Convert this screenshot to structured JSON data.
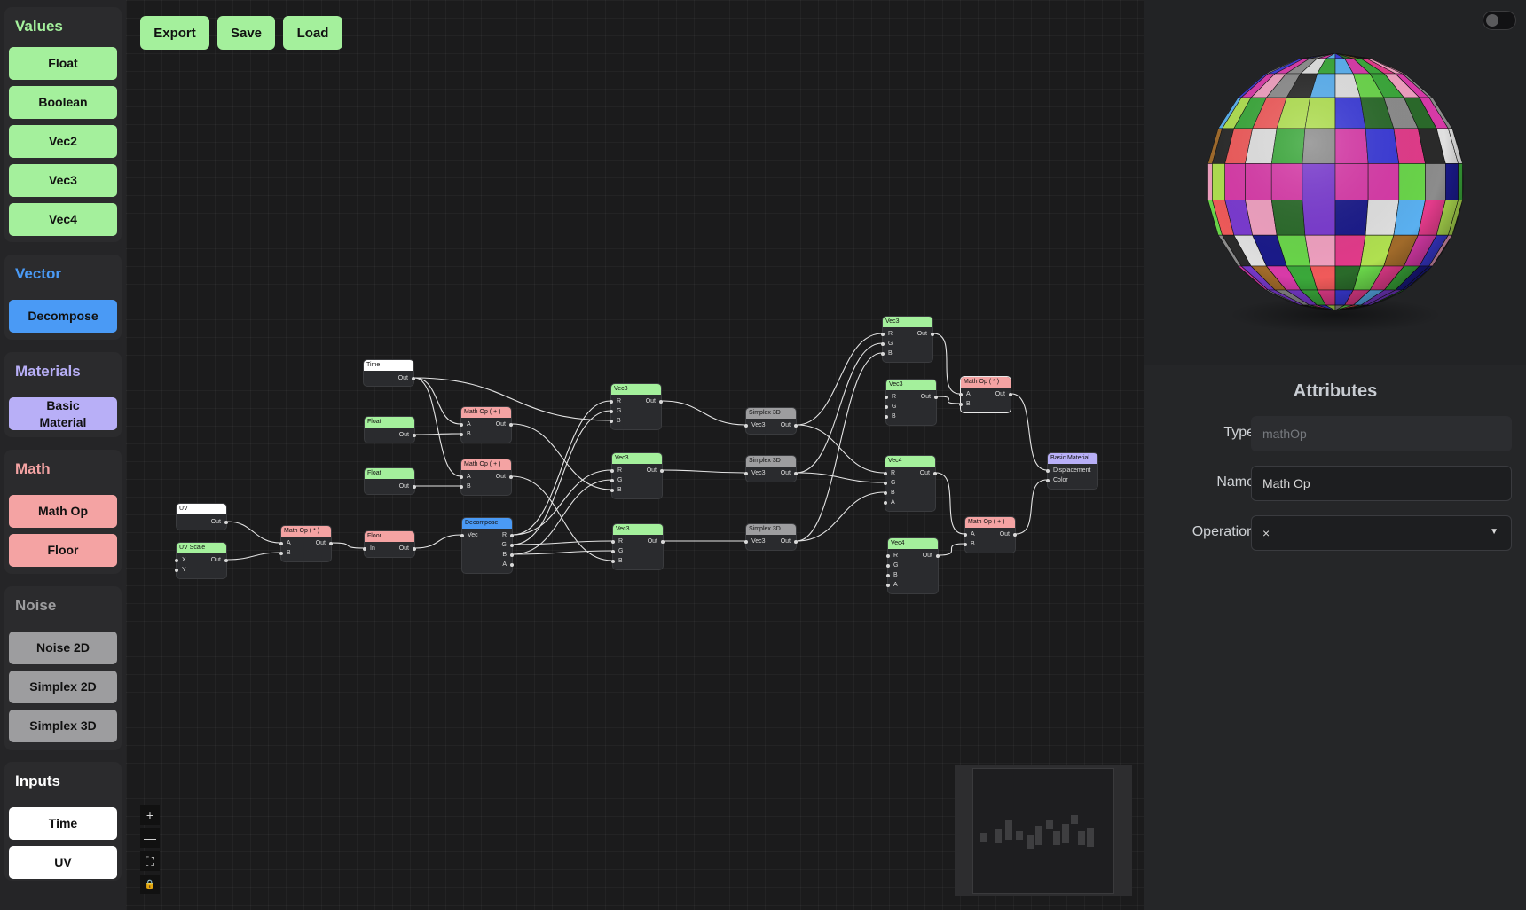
{
  "sidebar": {
    "categories": [
      {
        "title": "Values",
        "color": "#a4f09c",
        "items": [
          "Float",
          "Boolean",
          "Vec2",
          "Vec3",
          "Vec4"
        ]
      },
      {
        "title": "Vector",
        "color": "#4a9af5",
        "items": [
          "Decompose"
        ]
      },
      {
        "title": "Materials",
        "color": "#b8aff7",
        "items": [
          "Basic\nMaterial"
        ]
      },
      {
        "title": "Math",
        "color": "#f4a3a3",
        "items": [
          "Math Op",
          "Floor"
        ]
      },
      {
        "title": "Noise",
        "color": "#9d9d9f",
        "items": [
          "Noise 2D",
          "Simplex 2D",
          "Simplex 3D"
        ]
      },
      {
        "title": "Inputs",
        "color": "#ffffff",
        "items": [
          "Time",
          "UV"
        ]
      }
    ]
  },
  "toolbar": {
    "export_label": "Export",
    "save_label": "Save",
    "load_label": "Load",
    "button_color": "#a4f09c"
  },
  "graph": {
    "nodes": [
      {
        "id": "uv",
        "title": "UV",
        "color": "#ffffff",
        "inputs": [],
        "outputs": [
          "Out"
        ]
      },
      {
        "id": "uvscale",
        "title": "UV Scale",
        "color": "#a4f09c",
        "inputs": [
          "X",
          "Y"
        ],
        "outputs": [
          "Out"
        ]
      },
      {
        "id": "mul1",
        "title": "Math Op ( * )",
        "color": "#f4a3a3",
        "inputs": [
          "A",
          "B"
        ],
        "outputs": [
          "Out"
        ]
      },
      {
        "id": "floor",
        "title": "Floor",
        "color": "#f4a3a3",
        "inputs": [
          "In"
        ],
        "outputs": [
          "Out"
        ]
      },
      {
        "id": "time",
        "title": "Time",
        "color": "#ffffff",
        "inputs": [],
        "outputs": [
          "Out"
        ]
      },
      {
        "id": "float1",
        "title": "Float",
        "color": "#a4f09c",
        "inputs": [],
        "outputs": [
          "Out"
        ]
      },
      {
        "id": "float2",
        "title": "Float",
        "color": "#a4f09c",
        "inputs": [],
        "outputs": [
          "Out"
        ]
      },
      {
        "id": "add1",
        "title": "Math Op ( + )",
        "color": "#f4a3a3",
        "inputs": [
          "A",
          "B"
        ],
        "outputs": [
          "Out"
        ]
      },
      {
        "id": "add2",
        "title": "Math Op ( + )",
        "color": "#f4a3a3",
        "inputs": [
          "A",
          "B"
        ],
        "outputs": [
          "Out"
        ]
      },
      {
        "id": "decompose",
        "title": "Decompose",
        "color": "#4a9af5",
        "inputs": [
          "Vec"
        ],
        "outputs": [
          "R",
          "G",
          "B",
          "A"
        ]
      },
      {
        "id": "vec3a",
        "title": "Vec3",
        "color": "#a4f09c",
        "inputs": [
          "R",
          "G",
          "B"
        ],
        "outputs": [
          "Out"
        ]
      },
      {
        "id": "vec3b",
        "title": "Vec3",
        "color": "#a4f09c",
        "inputs": [
          "R",
          "G",
          "B"
        ],
        "outputs": [
          "Out"
        ]
      },
      {
        "id": "vec3c",
        "title": "Vec3",
        "color": "#a4f09c",
        "inputs": [
          "R",
          "G",
          "B"
        ],
        "outputs": [
          "Out"
        ]
      },
      {
        "id": "simp1",
        "title": "Simplex 3D",
        "color": "#9d9d9f",
        "inputs": [
          "Vec3"
        ],
        "outputs": [
          "Out"
        ]
      },
      {
        "id": "simp2",
        "title": "Simplex 3D",
        "color": "#9d9d9f",
        "inputs": [
          "Vec3"
        ],
        "outputs": [
          "Out"
        ]
      },
      {
        "id": "simp3",
        "title": "Simplex 3D",
        "color": "#9d9d9f",
        "inputs": [
          "Vec3"
        ],
        "outputs": [
          "Out"
        ]
      },
      {
        "id": "vec3d",
        "title": "Vec3",
        "color": "#a4f09c",
        "inputs": [
          "R",
          "G",
          "B"
        ],
        "outputs": [
          "Out"
        ]
      },
      {
        "id": "vec3e",
        "title": "Vec3",
        "color": "#a4f09c",
        "inputs": [
          "R",
          "G",
          "B"
        ],
        "outputs": [
          "Out"
        ]
      },
      {
        "id": "vec4a",
        "title": "Vec4",
        "color": "#a4f09c",
        "inputs": [
          "R",
          "G",
          "B",
          "A"
        ],
        "outputs": [
          "Out"
        ]
      },
      {
        "id": "vec4b",
        "title": "Vec4",
        "color": "#a4f09c",
        "inputs": [
          "R",
          "G",
          "B",
          "A"
        ],
        "outputs": [
          "Out"
        ]
      },
      {
        "id": "mul2",
        "title": "Math Op ( * )",
        "color": "#f4a3a3",
        "inputs": [
          "A",
          "B"
        ],
        "outputs": [
          "Out"
        ],
        "selected": true
      },
      {
        "id": "add3",
        "title": "Math Op ( + )",
        "color": "#f4a3a3",
        "inputs": [
          "A",
          "B"
        ],
        "outputs": [
          "Out"
        ]
      },
      {
        "id": "basicmat",
        "title": "Basic Material",
        "color": "#b8aff7",
        "inputs": [
          "Displacement",
          "Color"
        ],
        "outputs": []
      }
    ],
    "edges": [
      [
        "uv",
        "Out",
        "mul1",
        "A"
      ],
      [
        "uvscale",
        "Out",
        "mul1",
        "B"
      ],
      [
        "mul1",
        "Out",
        "floor",
        "In"
      ],
      [
        "floor",
        "Out",
        "decompose",
        "Vec"
      ],
      [
        "time",
        "Out",
        "add1",
        "A"
      ],
      [
        "time",
        "Out",
        "add2",
        "A"
      ],
      [
        "time",
        "Out",
        "vec3a",
        "B"
      ],
      [
        "float1",
        "Out",
        "add1",
        "B"
      ],
      [
        "float2",
        "Out",
        "add2",
        "B"
      ],
      [
        "add1",
        "Out",
        "vec3b",
        "B"
      ],
      [
        "add2",
        "Out",
        "vec3c",
        "B"
      ],
      [
        "decompose",
        "R",
        "vec3a",
        "R"
      ],
      [
        "decompose",
        "R",
        "vec3b",
        "R"
      ],
      [
        "decompose",
        "G",
        "vec3a",
        "G"
      ],
      [
        "decompose",
        "G",
        "vec3c",
        "R"
      ],
      [
        "decompose",
        "B",
        "vec3b",
        "G"
      ],
      [
        "decompose",
        "B",
        "vec3c",
        "G"
      ],
      [
        "vec3a",
        "Out",
        "simp1",
        "Vec3"
      ],
      [
        "vec3b",
        "Out",
        "simp2",
        "Vec3"
      ],
      [
        "vec3c",
        "Out",
        "simp3",
        "Vec3"
      ],
      [
        "simp1",
        "Out",
        "vec3d",
        "R"
      ],
      [
        "simp1",
        "Out",
        "vec4a",
        "R"
      ],
      [
        "simp2",
        "Out",
        "vec3d",
        "G"
      ],
      [
        "simp2",
        "Out",
        "vec4a",
        "G"
      ],
      [
        "simp3",
        "Out",
        "vec3d",
        "B"
      ],
      [
        "simp3",
        "Out",
        "vec4a",
        "B"
      ],
      [
        "vec3d",
        "Out",
        "mul2",
        "A"
      ],
      [
        "vec3e",
        "Out",
        "mul2",
        "B"
      ],
      [
        "vec4a",
        "Out",
        "add3",
        "A"
      ],
      [
        "vec4b",
        "Out",
        "add3",
        "B"
      ],
      [
        "mul2",
        "Out",
        "basicmat",
        "Displacement"
      ],
      [
        "add3",
        "Out",
        "basicmat",
        "Color"
      ]
    ]
  },
  "zoom_controls": [
    "+",
    "—",
    "⛶",
    "🔒"
  ],
  "preview": {
    "palette": [
      "#e23b8a",
      "#3a3ad8",
      "#3aa83a",
      "#8c8c8c",
      "#6ad64a",
      "#b0e050",
      "#2a2a2a",
      "#d83aa8",
      "#5ab0f0",
      "#a06a2a",
      "#e0e0e0",
      "#1a1a8a",
      "#f05a5a",
      "#7a3ad0",
      "#2a6a2a",
      "#f0a0c0"
    ]
  },
  "attributes": {
    "title": "Attributes",
    "type_label": "Type",
    "type_value": "mathOp",
    "name_label": "Name",
    "name_value": "Math Op",
    "operation_label": "Operation",
    "operation_value": "×"
  }
}
